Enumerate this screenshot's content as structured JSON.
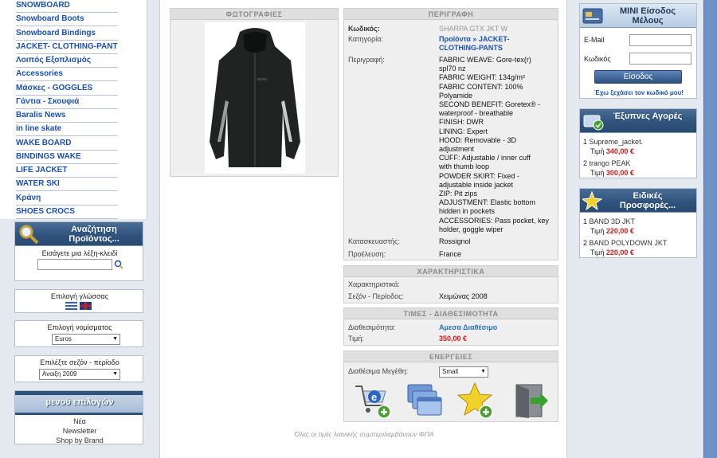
{
  "categories": [
    "SNOWBOARD",
    "Snowboard Boots",
    "Snowboard Bindings",
    "JACKET- CLOTHING-PANTS",
    "Λοιπός Εξοπλισμός",
    "Accessories",
    "Μάσκες - GOGGLES",
    "Γάντια - Σκουφιά",
    "Baralis News",
    "in line skate",
    "WAKE BOARD",
    "BINDINGS WAKE",
    "LIFE JACKET",
    "WATER SKI",
    "Κράνη",
    "SHOES CROCS"
  ],
  "search": {
    "title": "Αναζήτηση Προϊόντος...",
    "prompt": "Εισάγετε μια λέξη-κλειδί",
    "value": ""
  },
  "language": {
    "title": "Επιλογή γλώσσας"
  },
  "currency": {
    "title": "Επιλογή νομίσματος",
    "selected": "Euros"
  },
  "season": {
    "title": "Επιλέξτε σεζόν - περίοδο",
    "selected": "Ανοιξη 2009"
  },
  "menu": {
    "title": "μενού επιλογών",
    "items": [
      "Νέα",
      "Newsletter",
      "Shop by Brand"
    ]
  },
  "photos": {
    "header": "ΦΩΤΟΓΡΑΦΙΕΣ"
  },
  "description": {
    "header": "ΠΕΡΙΓΡΑΦΗ",
    "code_label": "Κωδικός:",
    "code_value": "SHARPA GTX JKT W",
    "category_label": "Κατηγορία:",
    "category_value": "Προϊόντα » JACKET- CLOTHING-PANTS",
    "desc_label": "Περιγραφή:",
    "desc_lines": [
      "FABRIC WEAVE: Gore-tex(r)",
      "spl70 nz",
      "FABRIC WEIGHT: 134g/m²",
      "FABRIC CONTENT: 100%",
      "Polyamide",
      "SECOND BENEFIT: Goretex® -",
      "waterproof - breathable",
      "FINISH: DWR",
      "LINING: Expert",
      "HOOD: Removable - 3D",
      "adjustment",
      "CUFF: Adjustable / inner cuff",
      "with thumb loop",
      "POWDER SKIRT: Fixed -",
      "adjustable inside jacket",
      "ZIP: Pit zips",
      "ADJUSTMENT: Elastic bottom",
      "hidden in pockets",
      "ACCESSORIES: Pass pocket, key",
      "holder, goggle wiper"
    ],
    "maker_label": "Κατασκευαστής:",
    "maker_value": "Rossignol",
    "origin_label": "Προέλευση:",
    "origin_value": "France"
  },
  "features": {
    "header": "ΧΑΡΑΚΤΗΡΙΣΤΙΚΑ",
    "features_label": "Χαρακτηριστικά:",
    "season_label": "Σεζόν - Περίοδος:",
    "season_value": "Χειμώνας 2008"
  },
  "prices": {
    "header": "ΤΙΜΕΣ - ΔΙΑΘΕΣΙΜΟΤΗΤΑ",
    "avail_label": "Διαθεσιμότητα:",
    "avail_value": "Αμεσα Διαθέσιμο",
    "price_label": "Τιμή:",
    "price_value": "350,00 €"
  },
  "actions": {
    "header": "ΕΝΕΡΓΕΙΕΣ",
    "sizes_label": "Διαθέσιμα Μεγέθη:",
    "size_selected": "Small"
  },
  "vat_note": "Όλες οι τιμές λιανικής συμπεριλαμβάνουν ΦΠΑ",
  "login": {
    "title": "MINI Είσοδος Μέλους",
    "email_label": "E-Mail",
    "password_label": "Κωδικός",
    "button": "Είσοδος",
    "forgot": "Έχω ξεχάσει τον κωδικό μου!"
  },
  "smart": {
    "title": "Έξυπνες Αγορές",
    "items": [
      {
        "num": "1",
        "name": "Supreme_jacket.",
        "price_label": "Τιμή",
        "price": "340,00 €"
      },
      {
        "num": "2",
        "name": "trango PEAK",
        "price_label": "Τιμή",
        "price": "300,00 €"
      }
    ]
  },
  "offers": {
    "title": "Ειδικές Προσφορές...",
    "items": [
      {
        "num": "1",
        "name": "BAND 3D JKT",
        "price_label": "Τιμή",
        "price": "220,00 €"
      },
      {
        "num": "2",
        "name": "BAND POLYDOWN JKT",
        "price_label": "Τιμή",
        "price": "220,00 €"
      }
    ]
  },
  "colors": {
    "link": "#1a4fb5",
    "price": "#d21b1b",
    "accent": "#2f527c"
  }
}
